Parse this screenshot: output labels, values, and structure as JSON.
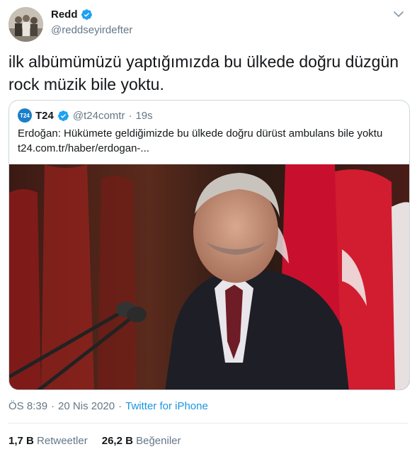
{
  "author": {
    "display_name": "Redd",
    "handle": "@reddseyirdefter",
    "verified": true
  },
  "tweet": {
    "text": "ilk albümümüzü yaptığımızda bu ülkede doğru düzgün rock müzik bile yoktu."
  },
  "quoted_tweet": {
    "avatar_text": "T24",
    "display_name": "T24",
    "handle": "@t24comtr",
    "separator": "·",
    "time": "19s",
    "text_line1": "Erdoğan: Hükümete geldiğimizde bu ülkede doğru dürüst ambulans bile yoktu",
    "text_line2": "t24.com.tr/haber/erdogan-..."
  },
  "meta": {
    "time": "ÖS 8:39",
    "separator": "·",
    "date": "20 Nis 2020",
    "separator2": "·",
    "source": "Twitter for iPhone"
  },
  "stats": {
    "retweets_count": "1,7 B",
    "retweets_label": "Retweetler",
    "likes_count": "26,2 B",
    "likes_label": "Beğeniler"
  },
  "colors": {
    "verified": "#1da1f2",
    "link": "#1b95e0",
    "secondary_text": "#657786",
    "flag_red": "#c8102e"
  },
  "icons": {
    "verified": "verified-badge-icon",
    "chevron": "chevron-down-icon"
  }
}
